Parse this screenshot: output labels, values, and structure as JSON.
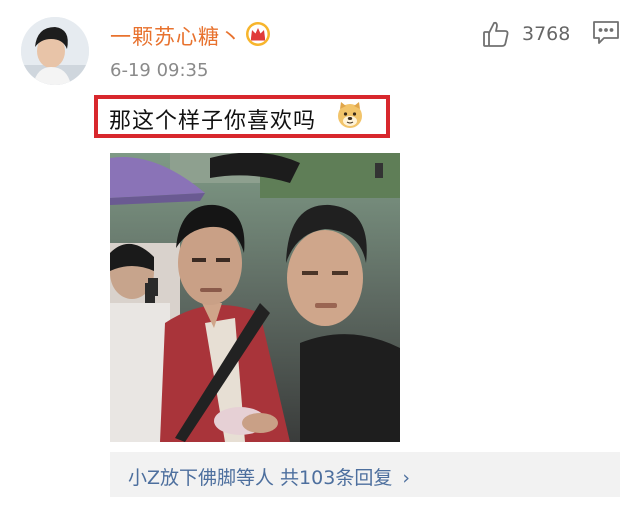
{
  "comment": {
    "username": "一颗苏心糖丶",
    "timestamp": "6-19 09:35",
    "likes": "3768",
    "text": "那这个样子你喜欢吗",
    "user_badge_icon": "crown-vip-icon",
    "emoji_icon": "doge-emoji-icon",
    "highlight_color": "#d8272d",
    "username_color": "#e8722e"
  },
  "replies": {
    "link_text": "小Z放下佛脚等人 共103条回复",
    "chevron": "›",
    "link_color": "#4d6f9e"
  },
  "actions": {
    "like_icon": "thumbs-up-icon",
    "comment_icon": "comment-icon"
  }
}
